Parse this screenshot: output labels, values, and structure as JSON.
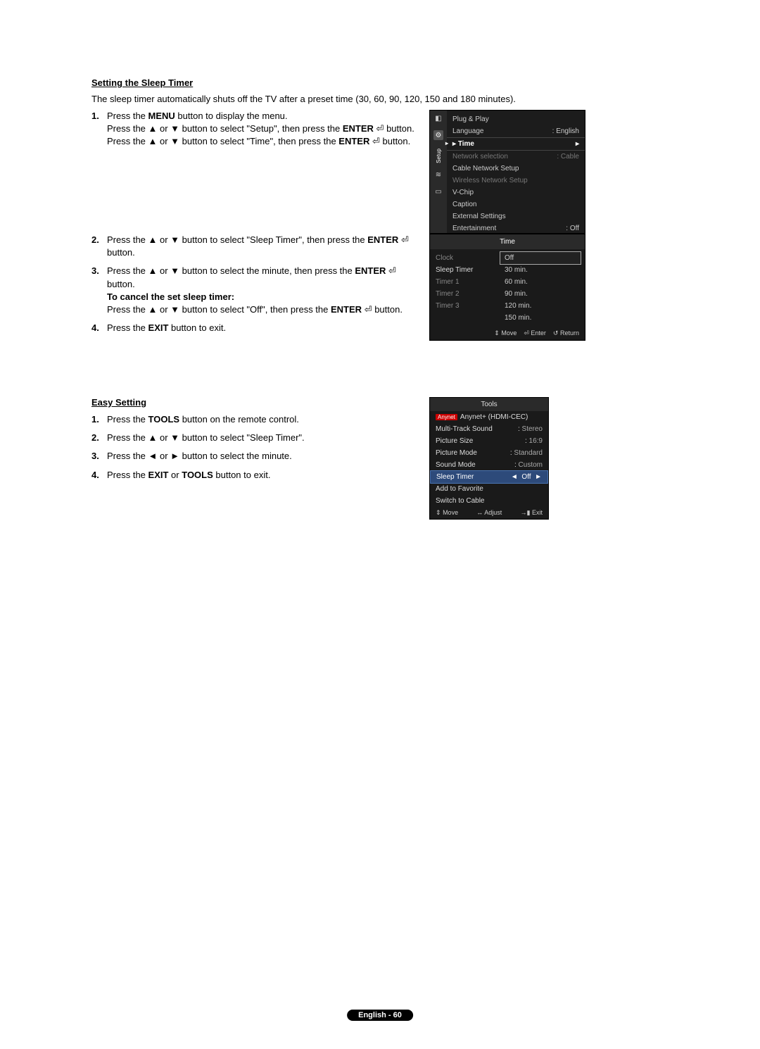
{
  "section1": {
    "title": "Setting the Sleep Timer",
    "intro": "The sleep timer automatically shuts off the TV after a preset time (30, 60, 90, 120, 150 and 180 minutes).",
    "steps": {
      "s1_line1a": "Press the ",
      "s1_menu": "MENU",
      "s1_line1b": " button to display the menu.",
      "s1_line2a": "Press the ▲ or ▼ button to select \"Setup\", then press the ",
      "s1_enter": "ENTER",
      "s1_line2b": " button.",
      "s1_line3a": "Press the ▲ or ▼ button to select \"Time\", then press the ",
      "s1_line3b": " button.",
      "s2a": "Press the ▲ or ▼ button to select \"Sleep Timer\", then press the ",
      "s2b": " button.",
      "s3a": "Press the ▲ or ▼ button to select the minute, then press the ",
      "s3b": " button.",
      "s3_cancel_title": "To cancel the set sleep timer:",
      "s3_cancel_a": "Press the ▲ or ▼ button to select \"Off\", then press the ",
      "s3_cancel_b": " button.",
      "s4a": "Press the ",
      "s4_exit": "EXIT",
      "s4b": " button to exit."
    }
  },
  "section2": {
    "title": "Easy Setting",
    "steps": {
      "s1a": "Press the ",
      "s1_tools": "TOOLS",
      "s1b": " button on the remote control.",
      "s2": "Press the ▲ or ▼ button to select \"Sleep Timer\".",
      "s3": "Press the ◄ or ► button to select the minute.",
      "s4a": "Press the ",
      "s4_exit": "EXIT",
      "s4_or": " or ",
      "s4_tools": "TOOLS",
      "s4b": " button to exit."
    }
  },
  "osd_setup": {
    "sidebar_label": "Setup",
    "items": [
      {
        "label": "Plug & Play",
        "value": ""
      },
      {
        "label": "Language",
        "value": ": English"
      },
      {
        "label": "Time",
        "value": "",
        "hl": true
      },
      {
        "label": "Network selection",
        "value": ": Cable",
        "dim": true
      },
      {
        "label": "Cable Network Setup",
        "value": ""
      },
      {
        "label": "Wireless Network Setup",
        "value": "",
        "dim": true
      },
      {
        "label": "V-Chip",
        "value": ""
      },
      {
        "label": "Caption",
        "value": ""
      },
      {
        "label": "External Settings",
        "value": ""
      },
      {
        "label": "Entertainment",
        "value": ": Off"
      }
    ]
  },
  "osd_time": {
    "header": "Time",
    "left": [
      "Clock",
      "Sleep Timer",
      "Timer 1",
      "Timer 2",
      "Timer 3"
    ],
    "options": [
      "Off",
      "30 min.",
      "60 min.",
      "90 min.",
      "120 min.",
      "150 min."
    ],
    "selected": "Off",
    "footer": {
      "move": "Move",
      "enter": "Enter",
      "return": "Return"
    }
  },
  "osd_tools": {
    "header": "Tools",
    "rows": [
      {
        "label": "Anynet+ (HDMI-CEC)",
        "value": "",
        "badge": true
      },
      {
        "label": "Multi-Track Sound",
        "value": "Stereo"
      },
      {
        "label": "Picture Size",
        "value": "16:9"
      },
      {
        "label": "Picture Mode",
        "value": "Standard"
      },
      {
        "label": "Sound Mode",
        "value": "Custom"
      },
      {
        "label": "Sleep Timer",
        "value": "Off",
        "hl": true
      },
      {
        "label": "Add to Favorite",
        "value": ""
      },
      {
        "label": "Switch to Cable",
        "value": ""
      }
    ],
    "footer": {
      "move": "Move",
      "adjust": "Adjust",
      "exit": "Exit"
    }
  },
  "page_footer": "English - 60",
  "glyphs": {
    "enter": "⏎",
    "updown": "⇕",
    "leftright": "↔",
    "return": "↺",
    "tri_left": "◄",
    "tri_right": "►"
  }
}
